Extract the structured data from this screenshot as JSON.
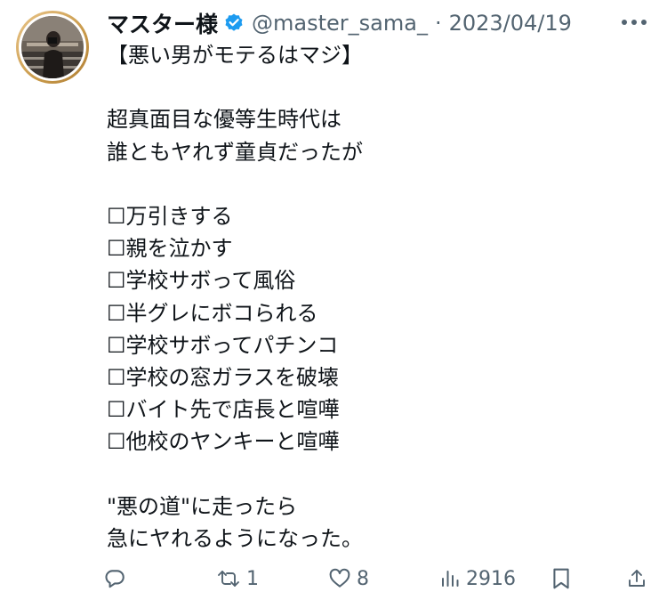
{
  "user": {
    "display_name": "マスター様",
    "handle": "@master_sama_",
    "separator": "·",
    "date": "2023/04/19"
  },
  "colors": {
    "verified": "#1d9bf0",
    "text": "#0f1419",
    "muted": "#536471"
  },
  "tweet": {
    "lines": [
      "【悪い男がモテるはマジ】",
      "",
      "超真面目な優等生時代は",
      "誰ともヤれず童貞だったが",
      "",
      "☐万引きする",
      "☐親を泣かす",
      "☐学校サボって風俗",
      "☐半グレにボコられる",
      "☐学校サボってパチンコ",
      "☐学校の窓ガラスを破壊",
      "☐バイト先で店長と喧嘩",
      "☐他校のヤンキーと喧嘩",
      "",
      "\"悪の道\"に走ったら",
      "急にヤれるようになった。"
    ]
  },
  "actions": {
    "reply_count": "",
    "retweet_count": "1",
    "like_count": "8",
    "views_count": "2916"
  },
  "icons": {
    "more": "more-icon",
    "reply": "reply-icon",
    "retweet": "retweet-icon",
    "like": "heart-icon",
    "views": "views-icon",
    "bookmark": "bookmark-icon",
    "share": "share-icon"
  }
}
